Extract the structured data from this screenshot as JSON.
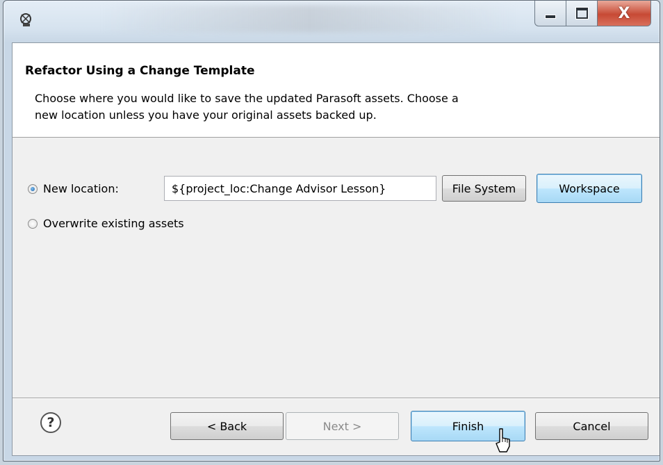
{
  "window": {
    "controls": {
      "minimize": "",
      "maximize": "",
      "close": "X"
    }
  },
  "header": {
    "title": "Refactor Using a Change Template",
    "description_line1": "Choose where you would like to save the updated Parasoft assets.  Choose a",
    "description_line2": "new location unless you have your original assets backed up."
  },
  "options": {
    "new_location_label": "New location:",
    "new_location_value": "${project_loc:Change Advisor Lesson}",
    "new_location_selected": true,
    "overwrite_label": "Overwrite existing assets",
    "overwrite_selected": false
  },
  "location_buttons": {
    "file_system": "File System",
    "workspace": "Workspace"
  },
  "footer": {
    "help": "?",
    "back": "< Back",
    "next": "Next >",
    "finish": "Finish",
    "cancel": "Cancel"
  },
  "icons": [
    "app-icon",
    "minimize-icon",
    "maximize-icon",
    "close-icon",
    "help-icon",
    "mouse-cursor-icon"
  ],
  "colors": {
    "close_button": "#c74a35",
    "focus_border": "#3c7fb1",
    "dialog_bg": "#f0f0f0",
    "header_bg": "#ffffff"
  }
}
